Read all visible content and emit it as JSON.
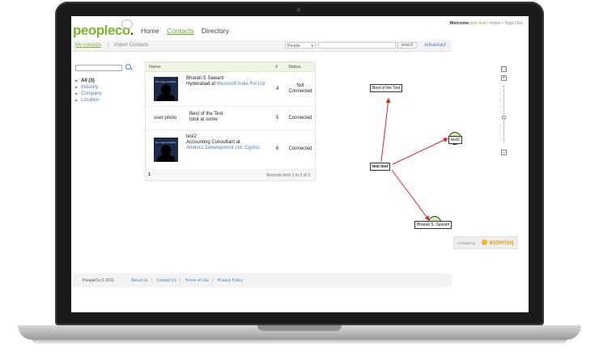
{
  "app": {
    "logo_main": "peopleco",
    "logo_suffix": ".",
    "nav": [
      "Home",
      "Contacts",
      "Directory"
    ],
    "active_nav": "Contacts"
  },
  "welcome": {
    "prefix": "Welcome",
    "user": "test test",
    "inbox": "Inbox",
    "signout": "Sign Out",
    "dot": "•"
  },
  "subnav": {
    "my_contacts": "My contacts",
    "separator": "|",
    "import": "Import Contacts",
    "search_scope": "People",
    "search_button": "search",
    "advanced": "Advanced"
  },
  "facets": {
    "all": "All (3)",
    "items": [
      "Industry",
      "Company",
      "Location"
    ]
  },
  "table": {
    "headers": {
      "name": "Name",
      "num": "#",
      "status": "Status"
    },
    "rows": [
      {
        "name": "Bharati S Sawant",
        "line1": "Hyderabad at",
        "company": "Microsoft India Pvt Ltd",
        "num": "4",
        "status": "Not Connected",
        "photo_text": "No image available"
      },
      {
        "photo_label": "user photo",
        "name": "Best of the Test",
        "line1": "totot at some",
        "num": "5",
        "status": "Connected"
      },
      {
        "name": "test2",
        "line1": "Accounting Consultant at",
        "company": "Amdocs Development Ltd, Cyprus",
        "num": "6",
        "status": "Connected",
        "photo_text": "No image available"
      }
    ],
    "page": "1",
    "records": "Records from 1 to 3 of 3"
  },
  "graph": {
    "nodes": {
      "center": "test test",
      "top": "Best of the Test",
      "right": "test2",
      "bottom": "Bharati S. Sawant"
    },
    "zoom_in": "+",
    "zoom_out": "−",
    "fit": "⛶",
    "zoom_level": 0.45,
    "edge_color": "#e02424"
  },
  "credit": {
    "created_by": "Created by",
    "brand": "asterisq"
  },
  "footer": {
    "copyright": "PeopleCo © 2011",
    "links": [
      "About Us",
      "Contact Us",
      "Terms of Use",
      "Privacy Policy"
    ],
    "pipe": "|"
  }
}
